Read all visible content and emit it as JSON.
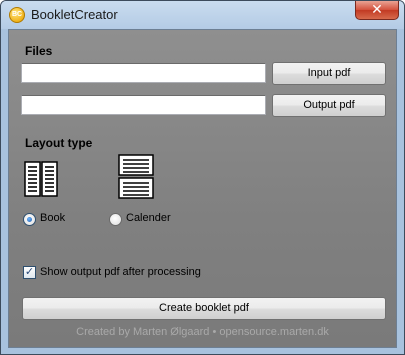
{
  "window": {
    "title": "BookletCreator",
    "icon_text": "BC",
    "close_glyph": "✕"
  },
  "files": {
    "section_label": "Files",
    "input_value": "",
    "output_value": "",
    "input_button_label": "Input pdf",
    "output_button_label": "Output pdf"
  },
  "layout": {
    "section_label": "Layout type",
    "book_icon": "book-layout-icon",
    "calendar_icon": "calendar-layout-icon",
    "options": [
      {
        "label": "Book",
        "selected": true
      },
      {
        "label": "Calender",
        "selected": false
      }
    ]
  },
  "options": {
    "show_output_label": "Show output pdf after processing",
    "show_output_checked": true,
    "check_glyph": "✓"
  },
  "actions": {
    "create_button_label": "Create booklet pdf"
  },
  "footer": {
    "credit": "Created by Marten Ølgaard • opensource.marten.dk"
  },
  "colors": {
    "client_background": "#808080",
    "footer_text": "#a9a9a9"
  }
}
